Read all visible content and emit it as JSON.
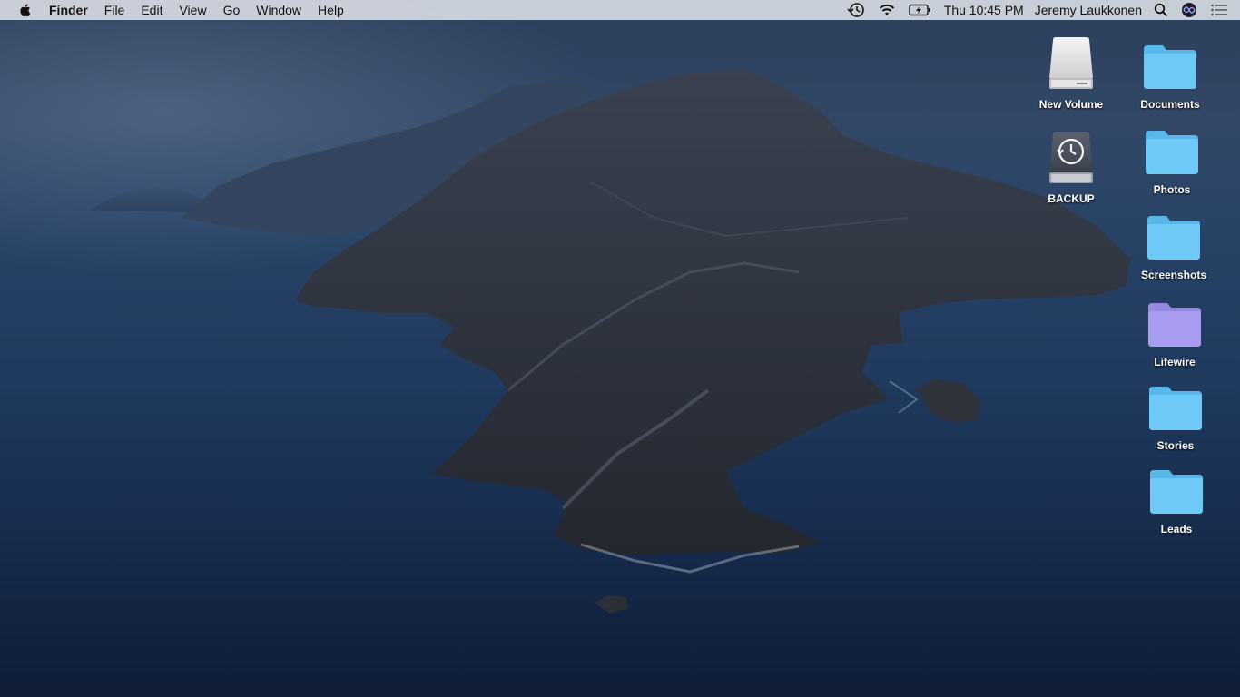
{
  "menubar": {
    "app_name": "Finder",
    "menus": [
      "File",
      "Edit",
      "View",
      "Go",
      "Window",
      "Help"
    ],
    "status": {
      "time_machine_icon": "time-machine-icon",
      "wifi_icon": "wifi-icon",
      "battery_icon": "battery-charging-icon",
      "clock": "Thu 10:45 PM",
      "user": "Jeremy Laukkonen",
      "spotlight_icon": "search-icon",
      "siri_icon": "siri-icon",
      "notification_icon": "notification-center-icon"
    }
  },
  "desktop": {
    "volumes": [
      {
        "label": "New Volume",
        "icon": "external-drive-icon"
      },
      {
        "label": "BACKUP",
        "icon": "time-machine-drive-icon"
      }
    ],
    "folders": [
      {
        "label": "Documents",
        "color": "#6ec9f7"
      },
      {
        "label": "Photos",
        "color": "#6ec9f7"
      },
      {
        "label": "Screenshots",
        "color": "#6ec9f7"
      },
      {
        "label": "Lifewire",
        "color": "#a89cf0"
      },
      {
        "label": "Stories",
        "color": "#6ec9f7"
      },
      {
        "label": "Leads",
        "color": "#6ec9f7"
      }
    ]
  }
}
